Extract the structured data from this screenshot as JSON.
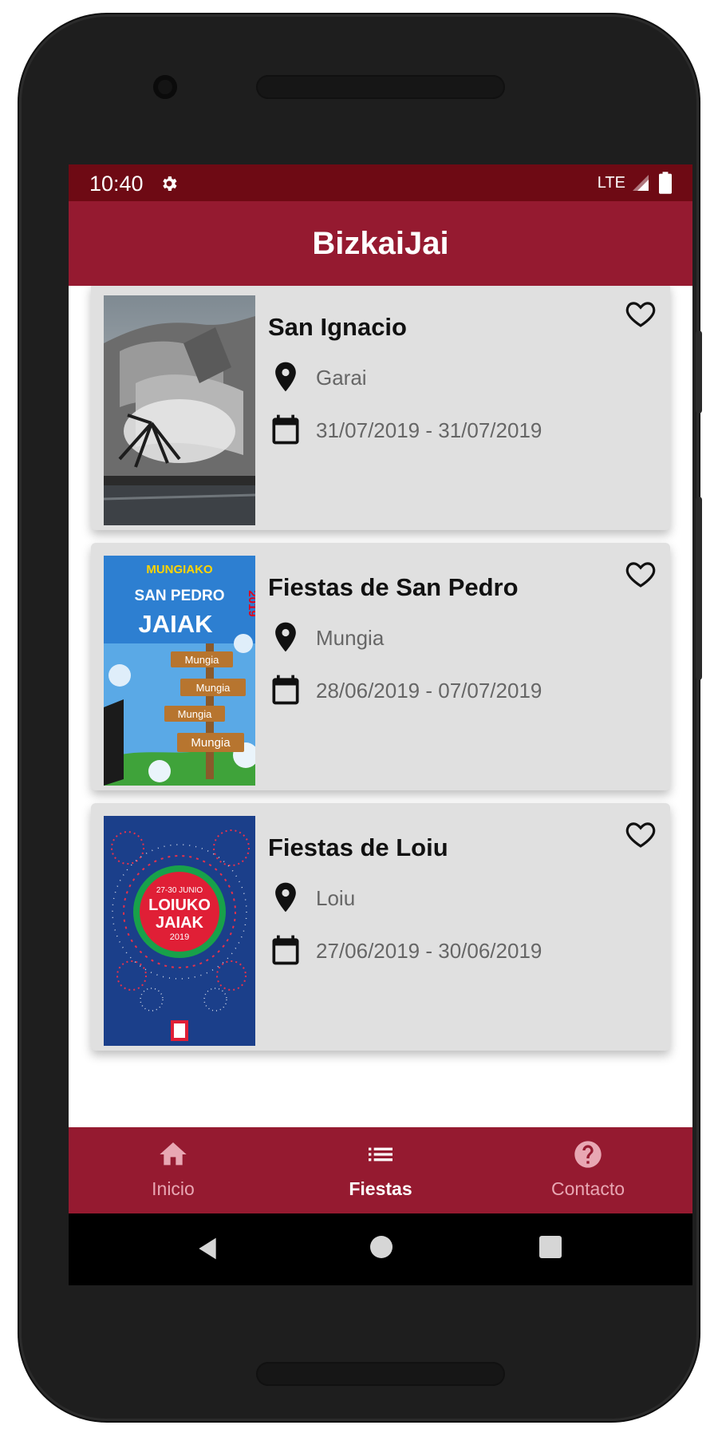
{
  "status": {
    "time": "10:40",
    "network": "LTE"
  },
  "app": {
    "title": "BizkaiJai"
  },
  "events": [
    {
      "name": "San Ignacio",
      "location": "Garai",
      "dates": "31/07/2019 - 31/07/2019"
    },
    {
      "name": "Fiestas de San Pedro",
      "location": "Mungia",
      "dates": "28/06/2019 - 07/07/2019"
    },
    {
      "name": "Fiestas de Loiu",
      "location": "Loiu",
      "dates": "27/06/2019 - 30/06/2019"
    }
  ],
  "posters": {
    "san_pedro": {
      "line1": "MUNGIAKO",
      "line2": "SAN PEDRO",
      "line3": "JAIAK",
      "year": "2019",
      "sign": "Mungia"
    },
    "loiu": {
      "dates": "27-30 JUNIO",
      "line1": "LOIUKO",
      "line2": "JAIAK",
      "year": "2019"
    }
  },
  "bottom_nav": {
    "items": [
      {
        "label": "Inicio",
        "icon": "home-icon",
        "active": false
      },
      {
        "label": "Fiestas",
        "icon": "list-icon",
        "active": true
      },
      {
        "label": "Contacto",
        "icon": "help-icon",
        "active": false
      }
    ]
  },
  "colors": {
    "primary": "#951a30",
    "status_bar": "#6e0a14",
    "card": "#e0e0e0",
    "nav_inactive": "#e8a7b3"
  }
}
